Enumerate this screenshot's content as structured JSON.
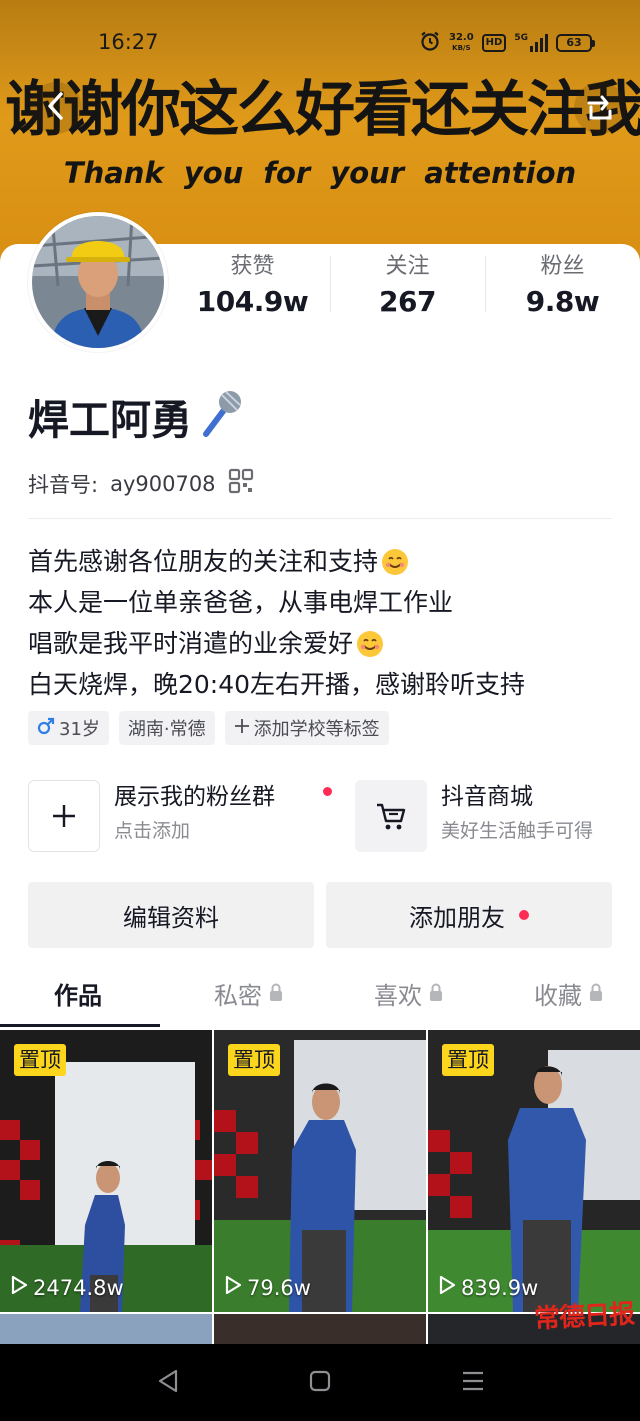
{
  "status_bar": {
    "time": "16:27",
    "speed_value": "32.0",
    "speed_unit": "KB/S",
    "hd": "HD",
    "network": "5G",
    "battery": "63"
  },
  "banner": {
    "title_zh": "谢谢你这么好看还关注我",
    "title_en": "Thank you for your attention"
  },
  "stats": [
    {
      "label": "获赞",
      "value": "104.9w"
    },
    {
      "label": "关注",
      "value": "267"
    },
    {
      "label": "粉丝",
      "value": "9.8w"
    }
  ],
  "profile": {
    "name": "焊工阿勇",
    "douyin_id_label": "抖音号:",
    "douyin_id": "ay900708",
    "bio": [
      "首先感谢各位朋友的关注和支持",
      "本人是一位单亲爸爸，从事电焊工作业",
      "唱歌是我平时消遣的业余爱好",
      "白天烧焊，晚20:40左右开播，感谢聆听支持"
    ],
    "tags": {
      "age": "31岁",
      "location": "湖南·常德",
      "add_tag": "添加学校等标签"
    }
  },
  "features": {
    "fan_group": {
      "title": "展示我的粉丝群",
      "subtitle": "点击添加"
    },
    "shop": {
      "title": "抖音商城",
      "subtitle": "美好生活触手可得"
    }
  },
  "buttons": {
    "edit_profile": "编辑资料",
    "add_friend": "添加朋友"
  },
  "tabs": [
    "作品",
    "私密",
    "喜欢",
    "收藏"
  ],
  "videos": [
    {
      "badge": "置顶",
      "plays": "2474.8w"
    },
    {
      "badge": "置顶",
      "plays": "79.6w"
    },
    {
      "badge": "置顶",
      "plays": "839.9w"
    }
  ],
  "watermark": "常德日报",
  "colors": {
    "accent_red": "#fe2c55",
    "pin_yellow": "#fcd51d",
    "banner_orange": "#e09a1a"
  },
  "icons": [
    "back-icon",
    "share-icon",
    "qr-code-icon",
    "microphone-icon",
    "male-icon",
    "plus-icon",
    "cart-icon",
    "lock-icon",
    "play-icon"
  ]
}
